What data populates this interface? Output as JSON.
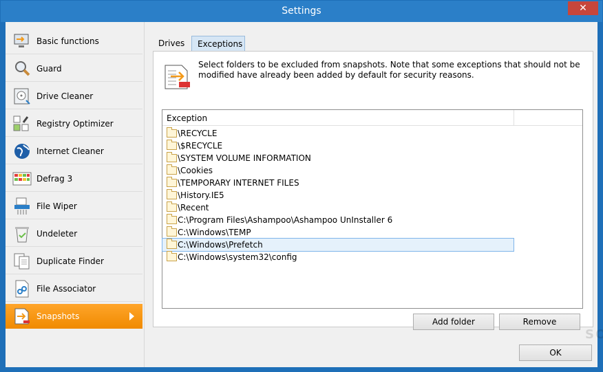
{
  "window": {
    "title": "Settings",
    "close_label": "✕"
  },
  "sidebar": {
    "items": [
      {
        "label": "Basic functions",
        "icon": "basic-functions-icon"
      },
      {
        "label": "Guard",
        "icon": "guard-icon"
      },
      {
        "label": "Drive Cleaner",
        "icon": "drive-cleaner-icon"
      },
      {
        "label": "Registry Optimizer",
        "icon": "registry-optimizer-icon"
      },
      {
        "label": "Internet Cleaner",
        "icon": "internet-cleaner-icon"
      },
      {
        "label": "Defrag 3",
        "icon": "defrag-icon"
      },
      {
        "label": "File Wiper",
        "icon": "file-wiper-icon"
      },
      {
        "label": "Undeleter",
        "icon": "undeleter-icon"
      },
      {
        "label": "Duplicate Finder",
        "icon": "duplicate-finder-icon"
      },
      {
        "label": "File Associator",
        "icon": "file-associator-icon"
      },
      {
        "label": "Snapshots",
        "icon": "snapshots-icon",
        "active": true
      }
    ]
  },
  "tabs": {
    "drives": "Drives",
    "exceptions": "Exceptions"
  },
  "exceptions": {
    "description": "Select folders to be excluded from snapshots. Note that some exceptions that should not be modified have already been added by default for security reasons.",
    "column_header": "Exception",
    "rows": [
      "\\RECYCLE",
      "\\$RECYCLE",
      "\\SYSTEM VOLUME INFORMATION",
      "\\Cookies",
      "\\TEMPORARY INTERNET FILES",
      "\\History.IE5",
      "\\Recent",
      "C:\\Program Files\\Ashampoo\\Ashampoo UnInstaller 6",
      "C:\\Windows\\TEMP",
      "C:\\Windows\\Prefetch",
      "C:\\Windows\\system32\\config"
    ],
    "selected_row": 9,
    "add_folder_label": "Add folder",
    "remove_label": "Remove"
  },
  "footer": {
    "ok_label": "OK"
  },
  "watermark": "SOFTPEDIA",
  "colors": {
    "accent": "#f39a1a",
    "titlebar": "#2b7fc8"
  }
}
